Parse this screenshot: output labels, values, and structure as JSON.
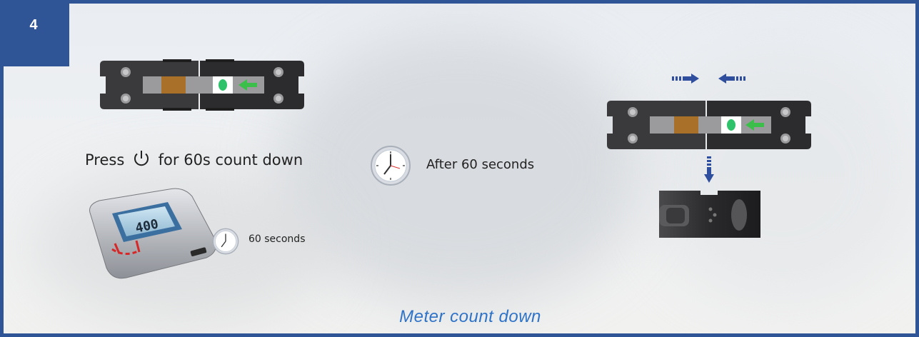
{
  "step": {
    "number": "4"
  },
  "instructions": {
    "press_prefix": "Press",
    "press_suffix": "for 60s count down",
    "after": "After 60 seconds",
    "meter_timer": "60 seconds"
  },
  "meter": {
    "display_value": "400"
  },
  "caption": "Meter count down",
  "colors": {
    "border": "#2f5597",
    "caption": "#2e73c8",
    "arrow_blue": "#2f4e9e",
    "arrow_green": "#3cbf4a",
    "dot_green": "#2ec26a"
  },
  "icons": [
    "power-icon",
    "clock-icon",
    "arrow-right-icon",
    "arrow-left-icon",
    "arrow-down-icon",
    "arrow-left-green-icon"
  ]
}
